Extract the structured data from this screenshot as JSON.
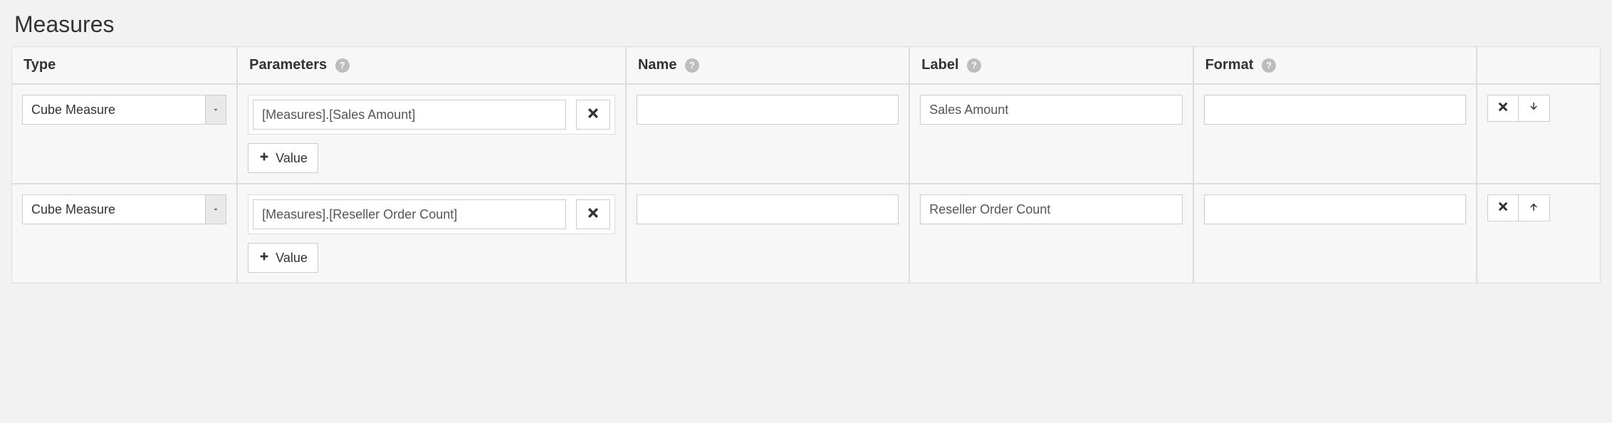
{
  "section": {
    "title": "Measures"
  },
  "columns": {
    "type": "Type",
    "parameters": "Parameters",
    "name": "Name",
    "label": "Label",
    "format": "Format"
  },
  "buttons": {
    "add_value": "Value"
  },
  "rows": [
    {
      "type": "Cube Measure",
      "parameter_value": "[Measures].[Sales Amount]",
      "name": "",
      "label": "Sales Amount",
      "format": "",
      "move": "down"
    },
    {
      "type": "Cube Measure",
      "parameter_value": "[Measures].[Reseller Order Count]",
      "name": "",
      "label": "Reseller Order Count",
      "format": "",
      "move": "up"
    }
  ]
}
